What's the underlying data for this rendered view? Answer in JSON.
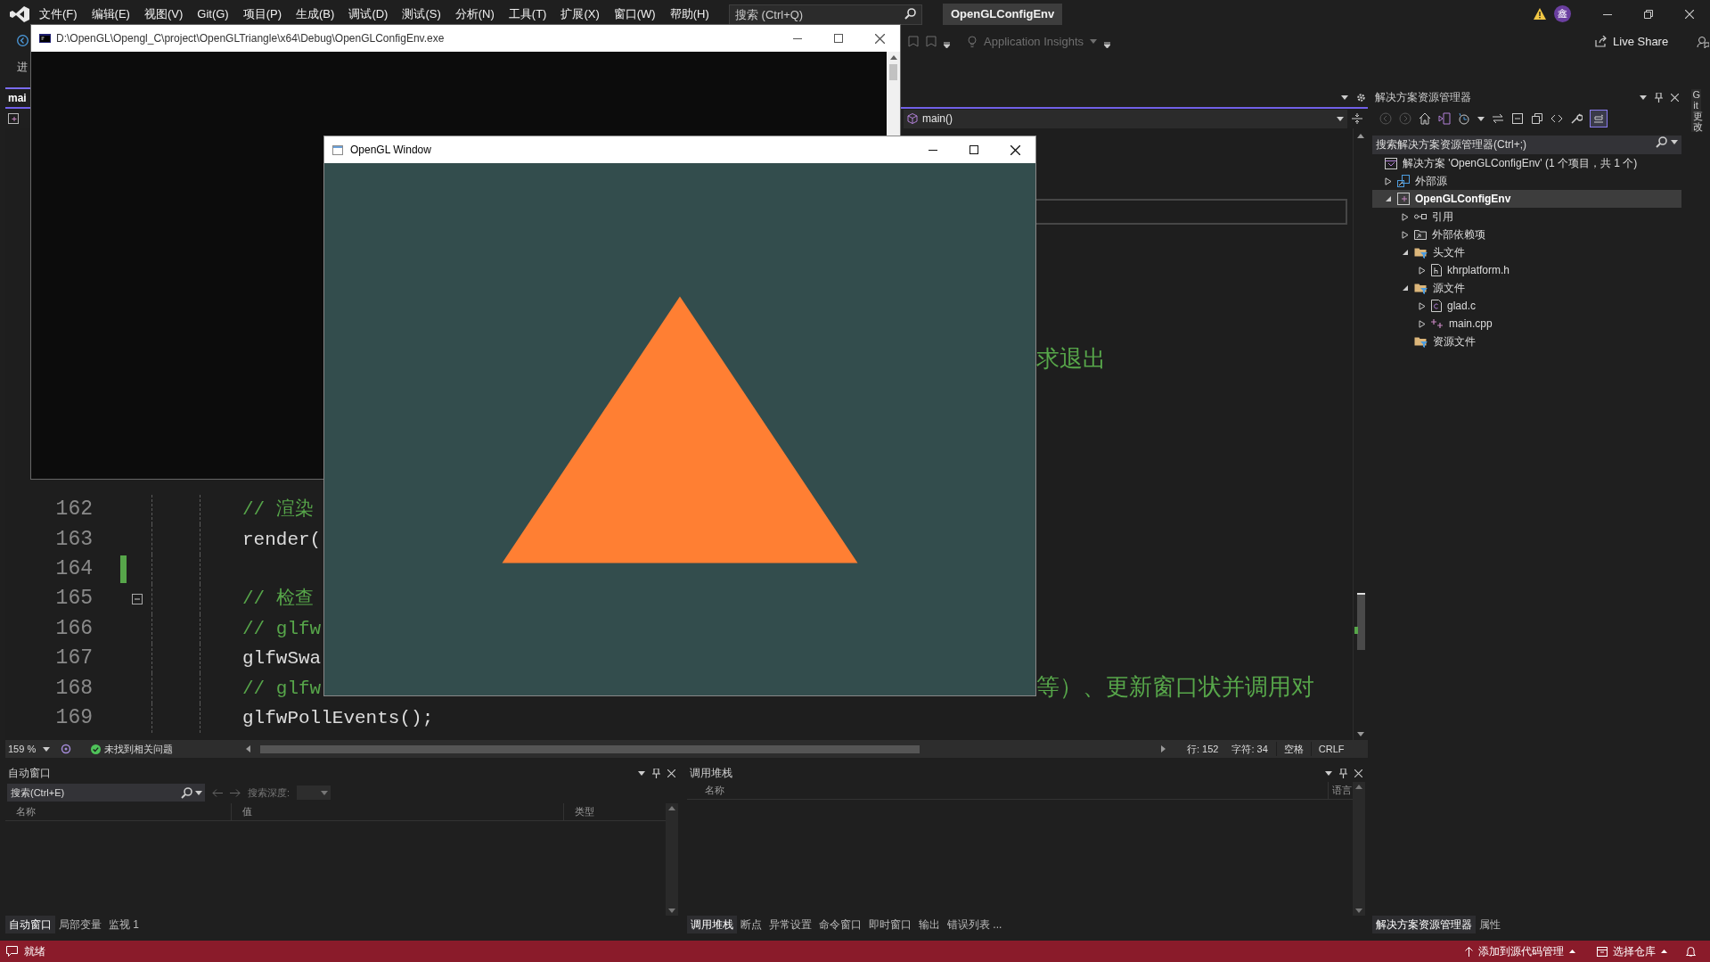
{
  "menu_bar": {
    "items": [
      "文件(F)",
      "编辑(E)",
      "视图(V)",
      "Git(G)",
      "项目(P)",
      "生成(B)",
      "调试(D)",
      "测试(S)",
      "分析(N)",
      "工具(T)",
      "扩展(X)",
      "窗口(W)",
      "帮助(H)"
    ],
    "search": {
      "placeholder": "搜索 (Ctrl+Q)"
    },
    "project_name": "OpenGLConfigEnv",
    "account_initial": "鑫"
  },
  "toolbar": {
    "left_label": "进",
    "insights": "Application Insights",
    "live_share": "Live Share"
  },
  "document_tab": {
    "label": "mai",
    "selected": true
  },
  "nav_bar": {
    "member": "main()"
  },
  "editor": {
    "fragment": "求退出",
    "lines": [
      {
        "number": "162",
        "text": "// 渲染",
        "kind": "comment",
        "changed": false,
        "fold": false
      },
      {
        "number": "163",
        "text": "render(",
        "kind": "code",
        "changed": false,
        "fold": false
      },
      {
        "number": "164",
        "kind": "code",
        "changed": true,
        "fold": false
      },
      {
        "number": "165",
        "text": "// 检查",
        "kind": "comment",
        "changed": false,
        "fold": true
      },
      {
        "number": "166",
        "text": "// glfw",
        "kind": "comment",
        "changed": false,
        "fold": false
      },
      {
        "number": "167",
        "text": "glfwSwa",
        "kind": "code",
        "changed": false,
        "fold": false
      },
      {
        "number": "168",
        "text": "// glfw",
        "tail": "等）、更新窗口状并调用对",
        "kind": "comment",
        "changed": false,
        "fold": false
      },
      {
        "number": "169",
        "text": "glfwPollEvents();",
        "kind": "code",
        "changed": false,
        "fold": false
      }
    ]
  },
  "editor_status": {
    "zoom": "159 %",
    "issues": "未找到相关问题",
    "line": "行: 152",
    "char": "字符: 34",
    "whitespace": "空格",
    "line_ending": "CRLF"
  },
  "autos_panel": {
    "title": "自动窗口",
    "search": {
      "placeholder": "搜索(Ctrl+E)"
    },
    "depth_label": "搜索深度:",
    "columns": [
      "名称",
      "值",
      "类型"
    ],
    "tabs": [
      {
        "label": "自动窗口",
        "selected": true
      },
      {
        "label": "局部变量",
        "selected": false
      },
      {
        "label": "监视 1",
        "selected": false
      }
    ]
  },
  "call_stack_panel": {
    "title": "调用堆栈",
    "columns": [
      "名称",
      "语言"
    ],
    "tabs": [
      {
        "label": "调用堆栈",
        "selected": true
      },
      {
        "label": "断点",
        "selected": false
      },
      {
        "label": "异常设置",
        "selected": false
      },
      {
        "label": "命令窗口",
        "selected": false
      },
      {
        "label": "即时窗口",
        "selected": false
      },
      {
        "label": "输出",
        "selected": false
      },
      {
        "label": "错误列表 ...",
        "selected": false
      }
    ]
  },
  "solution_explorer": {
    "title": "解决方案资源管理器",
    "search": {
      "placeholder": "搜索解决方案资源管理器(Ctrl+;)"
    },
    "tree": [
      {
        "label": "解决方案 'OpenGLConfigEnv' (1 个项目，共 1 个)",
        "kind": "solution",
        "selected": false,
        "children": [
          {
            "label": "外部源",
            "kind": "external",
            "expanded": false,
            "selected": false
          },
          {
            "label": "OpenGLConfigEnv",
            "kind": "project",
            "expanded": true,
            "selected": true,
            "children": [
              {
                "label": "引用",
                "kind": "references",
                "expanded": false,
                "selected": false
              },
              {
                "label": "外部依赖项",
                "kind": "dependencies",
                "expanded": false,
                "selected": false
              },
              {
                "label": "头文件",
                "kind": "filter",
                "expanded": true,
                "selected": false,
                "children": [
                  {
                    "label": "khrplatform.h",
                    "kind": "header",
                    "expanded": false,
                    "selected": false
                  }
                ]
              },
              {
                "label": "源文件",
                "kind": "filter",
                "expanded": true,
                "selected": false,
                "children": [
                  {
                    "label": "glad.c",
                    "kind": "c-source",
                    "expanded": false,
                    "selected": false
                  },
                  {
                    "label": "main.cpp",
                    "kind": "cpp-source",
                    "expanded": false,
                    "selected": false
                  }
                ]
              },
              {
                "label": "资源文件",
                "kind": "filter",
                "selected": false
              }
            ]
          }
        ]
      }
    ],
    "tabs": [
      {
        "label": "解决方案资源管理器",
        "selected": true
      },
      {
        "label": "属性",
        "selected": false
      }
    ]
  },
  "git_changes_tab": "Git 更改",
  "status_bar": {
    "message": "就绪",
    "source_control": "添加到源代码管理",
    "repository": "选择仓库"
  },
  "console_window": {
    "title": "D:\\OpenGL\\Opengl_C\\project\\OpenGLTriangle\\x64\\Debug\\OpenGLConfigEnv.exe"
  },
  "opengl_window": {
    "title": "OpenGL Window"
  }
}
